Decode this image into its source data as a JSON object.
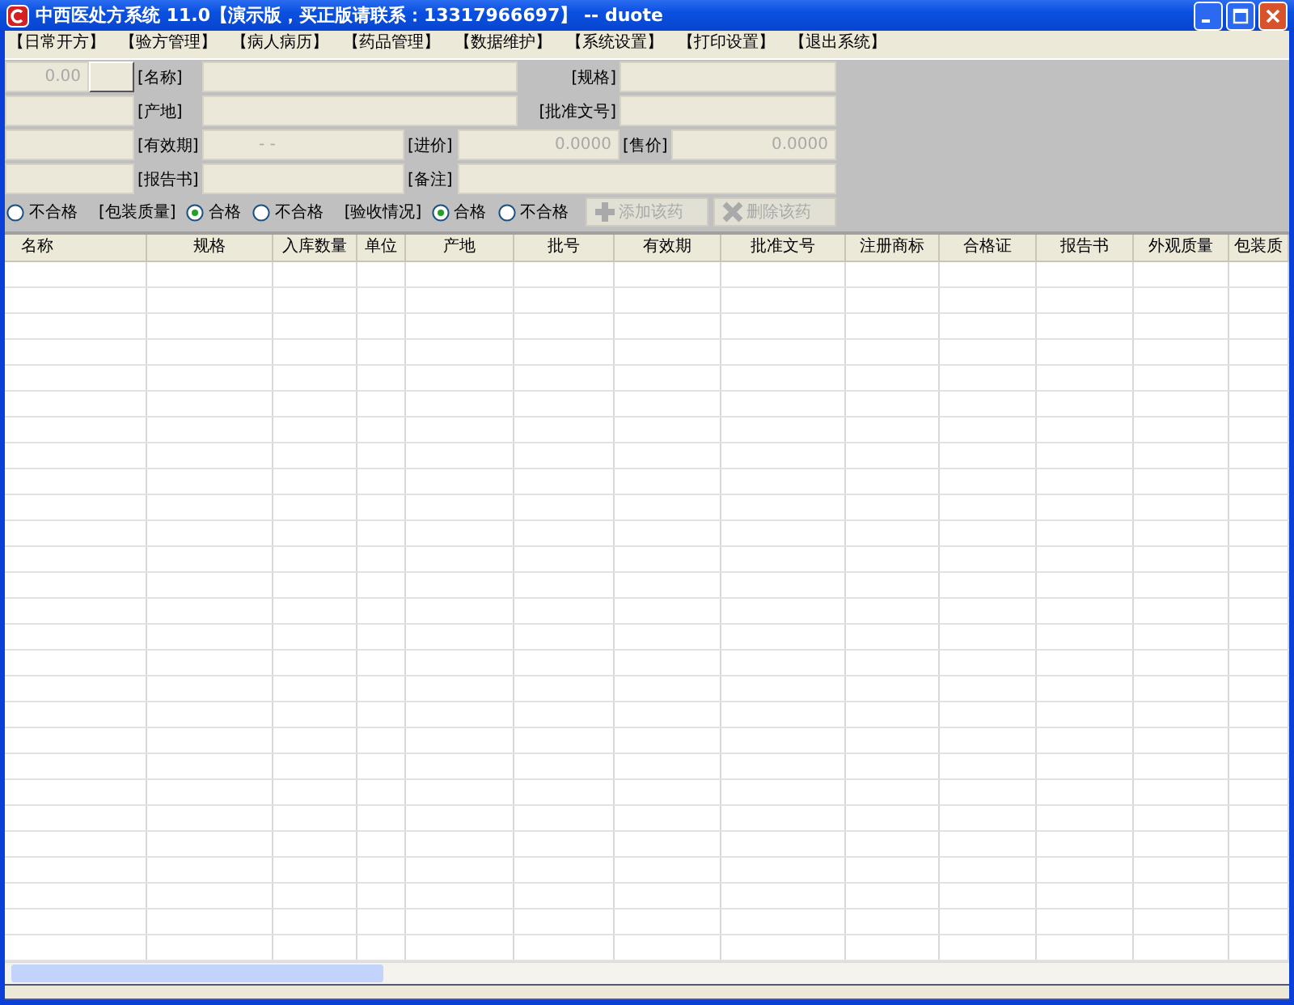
{
  "window": {
    "title": "中西医处方系统 11.0【演示版，买正版请联系：13317966697】 -- duote"
  },
  "menu": [
    "【日常开方】",
    "【验方管理】",
    "【病人病历】",
    "【药品管理】",
    "【数据维护】",
    "【系统设置】",
    "【打印设置】",
    "【退出系统】"
  ],
  "form": {
    "items": [
      {
        "kind": "field",
        "value": "0.00"
      },
      {
        "kind": "button"
      },
      {
        "kind": "label",
        "text": "[名称]"
      },
      {
        "kind": "field"
      },
      {
        "kind": "label",
        "text": "[规格]"
      },
      {
        "kind": "field"
      },
      {
        "kind": "field"
      },
      {
        "kind": "label",
        "text": "[产地]"
      },
      {
        "kind": "field"
      },
      {
        "kind": "label",
        "text": "[批准文号]"
      },
      {
        "kind": "field"
      },
      {
        "kind": "field"
      },
      {
        "kind": "label",
        "text": "[有效期]"
      },
      {
        "kind": "field",
        "value": "- -"
      },
      {
        "kind": "label",
        "text": "[进价]"
      },
      {
        "kind": "field",
        "value": "0.0000"
      },
      {
        "kind": "label",
        "text": "[售价]"
      },
      {
        "kind": "field",
        "value": "0.0000"
      },
      {
        "kind": "field"
      },
      {
        "kind": "label",
        "text": "[报告书]"
      },
      {
        "kind": "field"
      },
      {
        "kind": "label",
        "text": "[备注]"
      },
      {
        "kind": "field"
      }
    ],
    "options": [
      {
        "kind": "radio",
        "text": "不合格",
        "selected": false
      },
      {
        "kind": "label",
        "text": "[包装质量]"
      },
      {
        "kind": "radio",
        "text": "合格",
        "selected": true
      },
      {
        "kind": "radio",
        "text": "不合格",
        "selected": false
      },
      {
        "kind": "label",
        "text": "[验收情况]"
      },
      {
        "kind": "radio",
        "text": "合格",
        "selected": true
      },
      {
        "kind": "radio",
        "text": "不合格",
        "selected": false
      },
      {
        "kind": "button",
        "text": "添加该药",
        "disabled": true
      },
      {
        "kind": "button",
        "text": "删除该药",
        "disabled": true
      }
    ]
  },
  "table": {
    "columns": [
      "名称",
      "规格",
      "入库数量",
      "单位",
      "产地",
      "批号",
      "有效期",
      "批准文号",
      "注册商标",
      "合格证",
      "报告书",
      "外观质量",
      "包装质"
    ]
  }
}
